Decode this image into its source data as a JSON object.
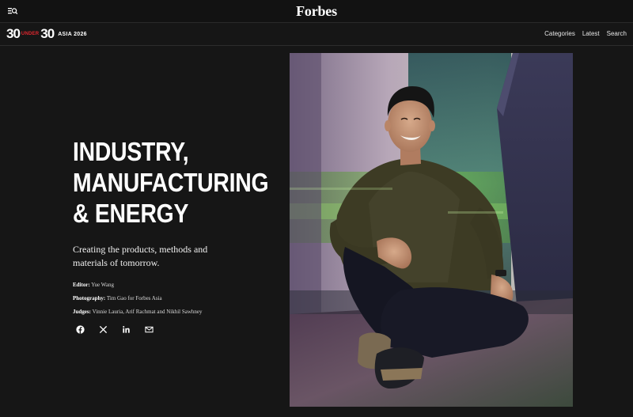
{
  "header": {
    "brand": "Forbes",
    "menu_icon": "menu-search-icon"
  },
  "subnav": {
    "logo": {
      "left_number": "30",
      "middle_word": "UNDER",
      "right_number": "30",
      "region": "ASIA 2026"
    },
    "links": [
      "Categories",
      "Latest",
      "Search"
    ]
  },
  "hero": {
    "headline_lines": [
      "INDUSTRY,",
      "MANUFACTURING",
      "& ENERGY"
    ],
    "dek": "Creating the products, methods and materials of tomorrow.",
    "credits": [
      {
        "label": "Editor:",
        "value": "Yue Wang"
      },
      {
        "label": "Photography:",
        "value": "Tim Gao for Forbes Asia"
      },
      {
        "label": "Judges:",
        "value": "Vinnie Lauria, Arif Rachmat and Nikhil Sawhney"
      }
    ],
    "share_icons": [
      "facebook-icon",
      "x-icon",
      "linkedin-icon",
      "email-icon"
    ]
  },
  "photo": {
    "description_icon": "honoree-portrait"
  },
  "colors": {
    "background": "#161616",
    "topbar": "#121212",
    "accent_red": "#e0262e",
    "text": "#ffffff"
  }
}
